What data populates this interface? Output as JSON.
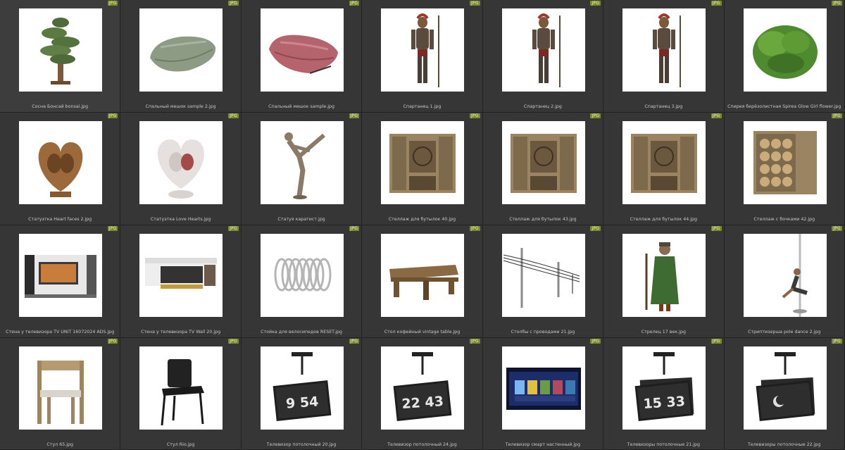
{
  "badge_label": "JPG",
  "items": [
    {
      "name": "Сосна Бонсай bonsai.jpg",
      "icon": "bonsai-tree"
    },
    {
      "name": "Спальный мешок sample 2.jpg",
      "icon": "sleeping-bag-green"
    },
    {
      "name": "Спальный мешок sample.jpg",
      "icon": "sleeping-bag-pink"
    },
    {
      "name": "Спартанец 1.jpg",
      "icon": "spartan-warrior"
    },
    {
      "name": "Спартанец 2.jpg",
      "icon": "spartan-warrior"
    },
    {
      "name": "Спартанец 3.jpg",
      "icon": "spartan-warrior"
    },
    {
      "name": "Спирея берёзолистная Spirea Glow Girl flower.jpg",
      "icon": "shrub"
    },
    {
      "name": "Статуэтка Heart faces 2.jpg",
      "icon": "heart-faces-statue"
    },
    {
      "name": "Статуэтка Love Hearts.jpg",
      "icon": "love-hearts-statue"
    },
    {
      "name": "Статуя каратист.jpg",
      "icon": "karate-statue"
    },
    {
      "name": "Стеллаж для бутылок 40.jpg",
      "icon": "bottle-rack"
    },
    {
      "name": "Стеллаж для бутылок 43.jpg",
      "icon": "bottle-rack"
    },
    {
      "name": "Стеллаж для бутылок 44.jpg",
      "icon": "bottle-rack"
    },
    {
      "name": "Стеллаж с бочками 42.jpg",
      "icon": "barrel-rack"
    },
    {
      "name": "Стена у телевизора TV UNIT 16072024 ADS.jpg",
      "icon": "tv-wall-unit"
    },
    {
      "name": "Стена у телевизора TV Wall 20.jpg",
      "icon": "tv-wall-unit-white"
    },
    {
      "name": "Стойка для велосипедов RESET.jpg",
      "icon": "bike-rack"
    },
    {
      "name": "Стол кофейный vintage table.jpg",
      "icon": "coffee-table"
    },
    {
      "name": "Столбы с проводами 21.jpg",
      "icon": "power-poles"
    },
    {
      "name": "Стрелец 17 век.jpg",
      "icon": "streltsy-soldier"
    },
    {
      "name": "Стриптизерша pole dance 2.jpg",
      "icon": "pole-dancer"
    },
    {
      "name": "Стул 65.jpg",
      "icon": "wooden-chair"
    },
    {
      "name": "Стул Rio.jpg",
      "icon": "black-chair"
    },
    {
      "name": "Телевизор потолочный 20.jpg",
      "icon": "ceiling-tv",
      "display": "9 54"
    },
    {
      "name": "Телевизор потолочный 24.jpg",
      "icon": "ceiling-tv",
      "display": "22 43"
    },
    {
      "name": "Телевизор смарт настенный.jpg",
      "icon": "smart-tv"
    },
    {
      "name": "Телевизоры потолочные 21.jpg",
      "icon": "ceiling-tv-double",
      "display": "15 33"
    },
    {
      "name": "Телевизоры потолочные 22.jpg",
      "icon": "ceiling-tv-double-moon"
    }
  ]
}
